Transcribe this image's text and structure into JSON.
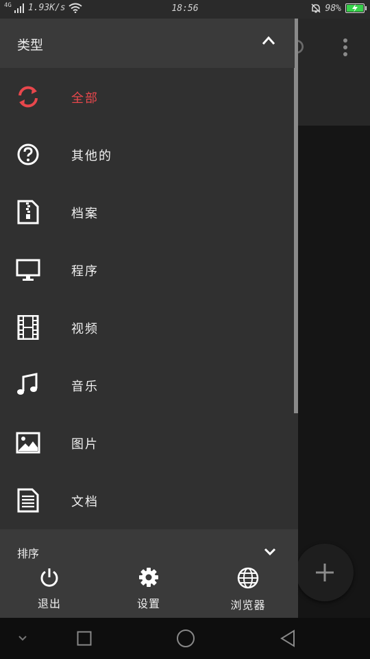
{
  "status_bar": {
    "network": "4G",
    "speed": "1.93K/s",
    "time": "18:56",
    "battery": "98%",
    "battery_level": 0.98,
    "battery_color": "#37d24b"
  },
  "drawer": {
    "type_section": {
      "label": "类型",
      "icon": "chevron-up-icon"
    },
    "items": [
      {
        "label": "全部",
        "icon": "refresh-icon",
        "active": true
      },
      {
        "label": "其他的",
        "icon": "help-circle-icon",
        "active": false
      },
      {
        "label": "档案",
        "icon": "archive-file-icon",
        "active": false
      },
      {
        "label": "程序",
        "icon": "monitor-icon",
        "active": false
      },
      {
        "label": "视频",
        "icon": "film-icon",
        "active": false
      },
      {
        "label": "音乐",
        "icon": "music-note-icon",
        "active": false
      },
      {
        "label": "图片",
        "icon": "image-icon",
        "active": false
      },
      {
        "label": "文档",
        "icon": "document-icon",
        "active": false
      }
    ],
    "sort_section": {
      "label": "排序",
      "icon": "chevron-down-icon"
    },
    "actions": [
      {
        "label": "退出",
        "icon": "power-icon"
      },
      {
        "label": "设置",
        "icon": "gear-icon"
      },
      {
        "label": "浏览器",
        "icon": "globe-icon"
      }
    ],
    "accent_color": "#e8474c"
  },
  "background_app": {
    "toolbar_icons": [
      "refresh-icon",
      "more-vert-icon"
    ],
    "fab_icon": "plus-icon"
  },
  "system_nav": {
    "buttons": [
      "collapse-icon",
      "recents-icon",
      "home-icon",
      "back-icon"
    ]
  }
}
